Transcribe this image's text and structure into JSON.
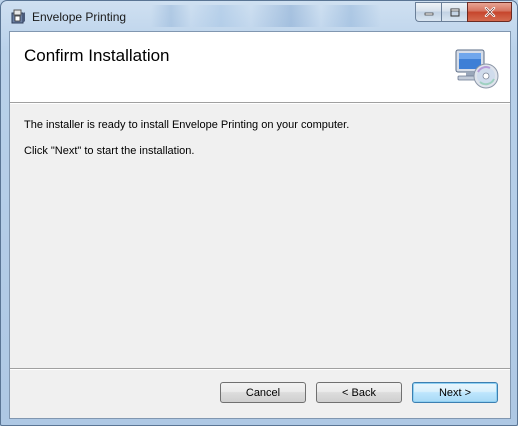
{
  "window": {
    "title": "Envelope Printing",
    "icon": "installer-box-icon",
    "controls": [
      "minimize-icon",
      "maximize-icon",
      "close-icon"
    ]
  },
  "header": {
    "title": "Confirm Installation",
    "art": "computer-cd-icon"
  },
  "body": {
    "line1": "The installer is ready to install Envelope Printing on your computer.",
    "line2": "Click \"Next\" to start the installation."
  },
  "buttons": {
    "cancel": "Cancel",
    "back": "< Back",
    "next": "Next >"
  },
  "colors": {
    "frame": "#b9d1ea",
    "close_button": "#c6452c",
    "default_button_border": "#3c7fb1"
  }
}
